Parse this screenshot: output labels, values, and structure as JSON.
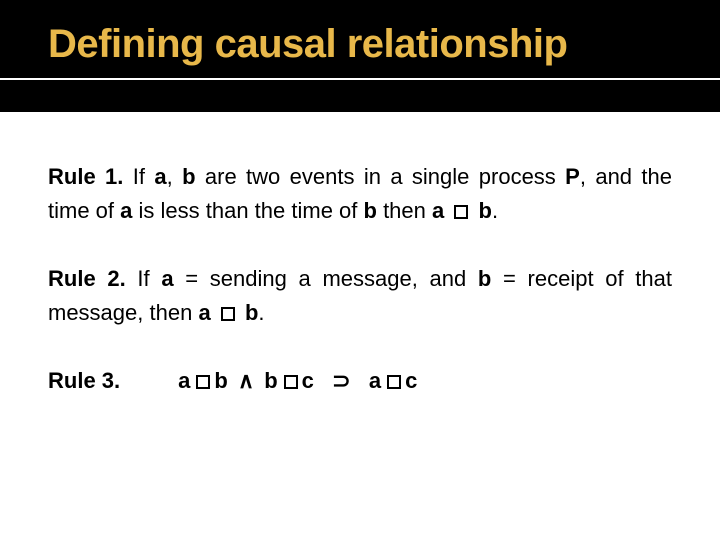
{
  "title": "Defining causal relationship",
  "rules": {
    "r1": {
      "label": "Rule 1.",
      "t1": "  If ",
      "t2": "a",
      "t3": ", ",
      "t4": "b",
      "t5": " are two events in a single process ",
      "t6": "P",
      "t7": ", and the time of ",
      "t8": "a",
      "t9": " is less than the time of ",
      "t10": "b",
      "t11": " then ",
      "t12": "a",
      "t13": " ",
      "t14": "b",
      "t15": "."
    },
    "r2": {
      "label": "Rule 2.",
      "t1": "  If ",
      "t2": "a",
      "t3": " = sending a message, and ",
      "t4": "b",
      "t5": " = receipt of that message, then ",
      "t6": "a",
      "t7": " ",
      "t8": "b",
      "t9": "."
    },
    "r3": {
      "label": "Rule 3.",
      "a": "a",
      "b": "b",
      "wedge": "∧",
      "c": "c",
      "implies": "⊃"
    }
  }
}
